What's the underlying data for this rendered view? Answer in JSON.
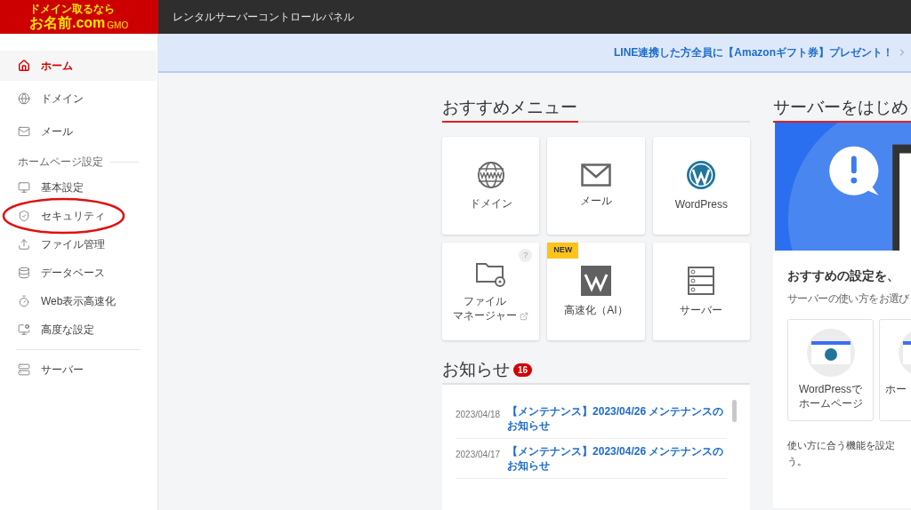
{
  "logo": {
    "tagline": "ドメイン取るなら",
    "name": "お名前.com",
    "suffix": "GMO"
  },
  "header": {
    "title": "レンタルサーバーコントロールパネル"
  },
  "sidebar": {
    "main_items": [
      {
        "label": "ホーム",
        "selected": true,
        "circled": false
      },
      {
        "label": "ドメイン",
        "selected": false,
        "circled": false
      },
      {
        "label": "メール",
        "selected": false,
        "circled": false
      }
    ],
    "section": {
      "label": "ホームページ設定",
      "items": [
        {
          "label": "基本設定",
          "selected": false,
          "circled": false
        },
        {
          "label": "セキュリティ",
          "selected": false,
          "circled": true
        },
        {
          "label": "ファイル管理",
          "selected": false,
          "circled": false
        },
        {
          "label": "データベース",
          "selected": false,
          "circled": false
        },
        {
          "label": "Web表示高速化",
          "selected": false,
          "circled": false
        },
        {
          "label": "高度な設定",
          "selected": false,
          "circled": false
        }
      ]
    },
    "bottom_items": [
      {
        "label": "サーバー",
        "selected": false,
        "circled": false
      }
    ]
  },
  "banner": {
    "text": "LINE連携した方全員に【Amazonギフト券】プレゼント！"
  },
  "recommended": {
    "title": "おすすめメニュー",
    "tiles": [
      {
        "label": [
          "ドメイン"
        ]
      },
      {
        "label": [
          "メール"
        ]
      },
      {
        "label": [
          "WordPress"
        ]
      },
      {
        "label": [
          "ファイル",
          "マネージャー"
        ],
        "help": "?",
        "external": true
      },
      {
        "label": [
          "高速化（AI）"
        ],
        "badge": "NEW"
      },
      {
        "label": [
          "サーバー"
        ]
      }
    ]
  },
  "notices": {
    "title": "お知らせ",
    "count": "16",
    "items": [
      {
        "date": "2023/04/18",
        "title": "【メンテナンス】2023/04/26 メンテナンスのお知らせ"
      },
      {
        "date": "2023/04/17",
        "title": "【メンテナンス】2023/04/26 メンテナンスのお知らせ"
      }
    ]
  },
  "getting_started": {
    "title": "サーバーをはじめ",
    "heading": "おすすめの設定を、",
    "subtext": "サーバーの使い方をお選び",
    "options": [
      {
        "label": [
          "WordPressで",
          "ホームページ"
        ]
      },
      {
        "label": [
          "ホー"
        ]
      }
    ],
    "note": [
      "使い方に合う機能を設定",
      "う。"
    ]
  }
}
